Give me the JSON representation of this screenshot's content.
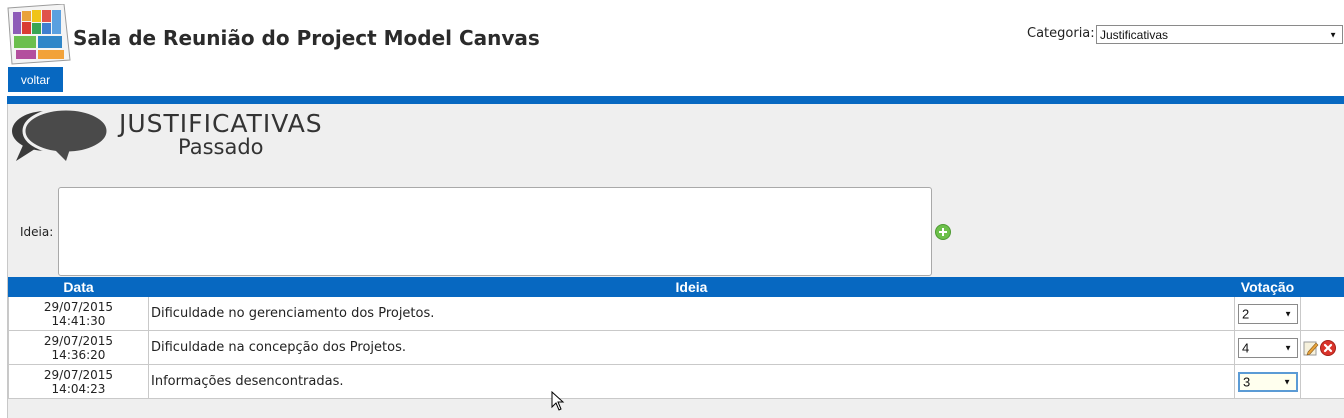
{
  "header": {
    "title": "Sala de Reunião do Project Model Canvas",
    "category_label": "Categoria:",
    "category_value": "Justificativas",
    "back_label": "voltar"
  },
  "section": {
    "title": "JUSTIFICATIVAS",
    "subtitle": "Passado"
  },
  "form": {
    "idea_label": "Ideia:",
    "idea_value": ""
  },
  "table": {
    "headers": {
      "date": "Data",
      "idea": "Ideia",
      "vote": "Votação"
    },
    "rows": [
      {
        "date": "29/07/2015",
        "time": "14:41:30",
        "idea": "Dificuldade no gerenciamento dos Projetos.",
        "vote": "2"
      },
      {
        "date": "29/07/2015",
        "time": "14:36:20",
        "idea": "Dificuldade na concepção dos Projetos.",
        "vote": "4"
      },
      {
        "date": "29/07/2015",
        "time": "14:04:23",
        "idea": "Informações desencontradas.",
        "vote": "3"
      }
    ]
  },
  "icons": {
    "logo": "canvas-grid-logo",
    "section": "speech-bubbles-icon",
    "add": "plus-circle-icon",
    "edit": "pencil-edit-icon",
    "delete": "x-circle-icon",
    "dropdown": "chevron-down-icon"
  },
  "colors": {
    "brand_blue": "#0768c1",
    "panel_gray": "#efefef",
    "add_green": "#6cc04a",
    "delete_red": "#d9342b"
  }
}
